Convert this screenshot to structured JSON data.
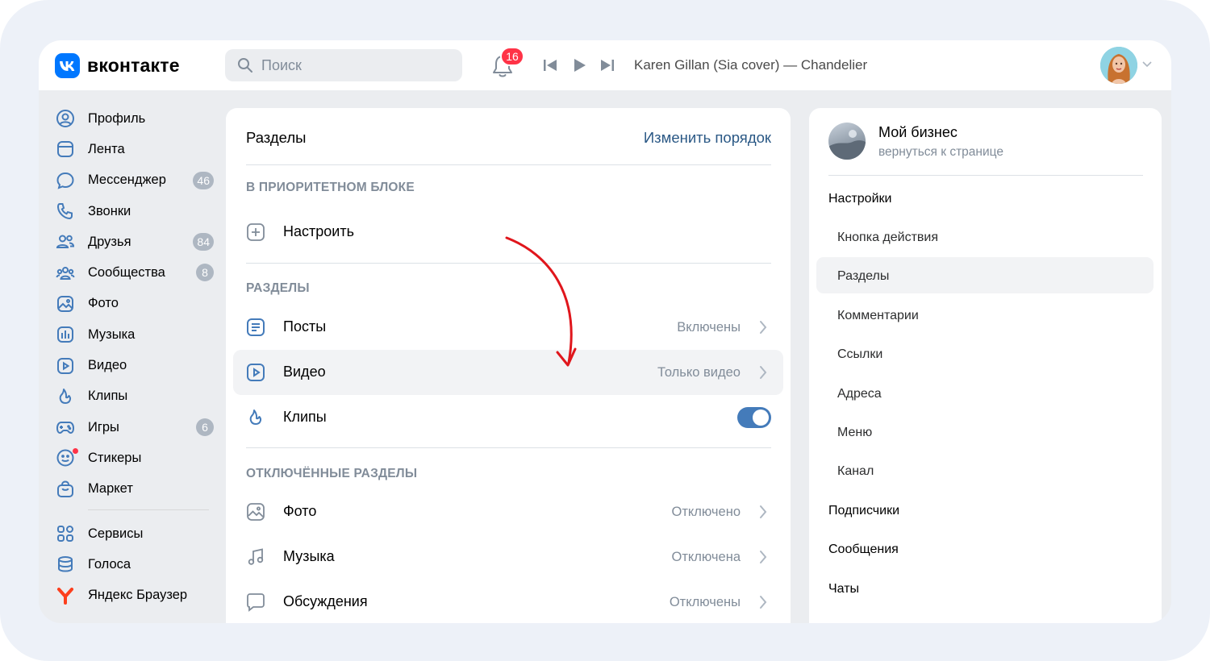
{
  "header": {
    "logo_text": "вконтакте",
    "search_placeholder": "Поиск",
    "notifications_count": "16",
    "track": "Karen Gillan (Sia cover) — Chandelier"
  },
  "nav": {
    "items": [
      {
        "label": "Профиль",
        "icon": "user-circle-icon"
      },
      {
        "label": "Лента",
        "icon": "feed-icon"
      },
      {
        "label": "Мессенджер",
        "icon": "message-icon",
        "count": "46"
      },
      {
        "label": "Звонки",
        "icon": "phone-icon"
      },
      {
        "label": "Друзья",
        "icon": "friends-icon",
        "count": "84"
      },
      {
        "label": "Сообщества",
        "icon": "communities-icon",
        "count": "8"
      },
      {
        "label": "Фото",
        "icon": "photo-icon"
      },
      {
        "label": "Музыка",
        "icon": "music-icon"
      },
      {
        "label": "Видео",
        "icon": "video-icon"
      },
      {
        "label": "Клипы",
        "icon": "clips-icon"
      },
      {
        "label": "Игры",
        "icon": "gamepad-icon",
        "count": "6"
      },
      {
        "label": "Стикеры",
        "icon": "sticker-icon"
      },
      {
        "label": "Маркет",
        "icon": "market-icon"
      }
    ],
    "extra": [
      {
        "label": "Сервисы",
        "icon": "services-icon"
      },
      {
        "label": "Голоса",
        "icon": "votes-icon"
      },
      {
        "label": "Яндекс Браузер",
        "icon": "yandex-browser-icon"
      }
    ]
  },
  "main": {
    "title": "Разделы",
    "action": "Изменить порядок",
    "priority_title": "В ПРИОРИТЕТНОМ БЛОКЕ",
    "configure": "Настроить",
    "sections_title": "РАЗДЕЛЫ",
    "sections": [
      {
        "label": "Посты",
        "value": "Включены"
      },
      {
        "label": "Видео",
        "value": "Только видео"
      },
      {
        "label": "Клипы",
        "toggle": true
      }
    ],
    "disabled_title": "ОТКЛЮЧЁННЫЕ РАЗДЕЛЫ",
    "disabled": [
      {
        "label": "Фото",
        "value": "Отключено"
      },
      {
        "label": "Музыка",
        "value": "Отключена"
      },
      {
        "label": "Обсуждения",
        "value": "Отключены"
      }
    ]
  },
  "right": {
    "name": "Мой бизнес",
    "back": "вернуться к странице",
    "settings": "Настройки",
    "sub_items": [
      "Кнопка действия",
      "Разделы",
      "Комментарии",
      "Ссылки",
      "Адреса",
      "Меню",
      "Канал"
    ],
    "items": [
      "Подписчики",
      "Сообщения",
      "Чаты"
    ]
  },
  "colors": {
    "accent": "#0077ff",
    "link": "#2a5885",
    "badge": "#ff3347",
    "toggle": "#447bba",
    "annotation_arrow": "#e0161c"
  }
}
